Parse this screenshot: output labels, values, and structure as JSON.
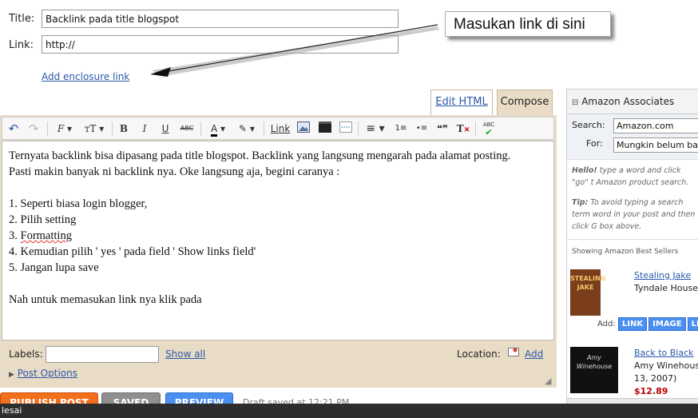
{
  "form": {
    "title_label": "Title:",
    "title_value": "Backlink pada title blogspot",
    "link_label": "Link:",
    "link_value": "http://",
    "enclosure_link": "Add enclosure link"
  },
  "callout": {
    "text": "Masukan link di sini"
  },
  "tabs": {
    "edit_html": "Edit HTML",
    "compose": "Compose"
  },
  "toolbar": {
    "undo": "↶",
    "redo": "↷",
    "font": "F",
    "size": "тT",
    "bold": "B",
    "italic": "I",
    "underline": "U",
    "strike": "ABC",
    "text_color": "A",
    "highlight": "✎",
    "link": "Link",
    "align": "≡",
    "ol": "1≡",
    "ul": "•≡",
    "quote": "❝❞",
    "clear": "T",
    "spell": "ABC"
  },
  "post": {
    "lines": [
      "Ternyata backlink bisa dipasang pada title blogspot. Backlink yang langsung mengarah pada alamat posting.",
      "Pasti makin banyak ni backlink nya. Oke langsung aja, begini caranya :",
      "",
      "1. Seperti biasa login blogger,",
      "2. Pilih setting",
      "3. Formatting",
      "4. Kemudian pilih ' yes ' pada field ' Show links field'",
      "5. Jangan lupa save",
      "",
      "Nah untuk memasukan link nya klik pada"
    ]
  },
  "labels": {
    "label": "Labels:",
    "show_all": "Show all",
    "location_label": "Location:",
    "add": "Add",
    "post_options": "Post Options"
  },
  "actions": {
    "publish": "PUBLISH POST",
    "saved": "SAVED",
    "preview": "PREVIEW",
    "draft_status": "Draft saved at 12:21 PM"
  },
  "sidebar": {
    "title": "Amazon Associates",
    "search_label": "Search:",
    "search_value": "Amazon.com",
    "for_label": "For:",
    "for_value": "Mungkin belum banya",
    "help_prefix": "Hello!",
    "help_text": " type a word and click \"go\" t Amazon product search.",
    "tip_prefix": "Tip:",
    "tip_text": " To avoid typing a search term word in your post and then click G box above.",
    "best_sellers": "Showing Amazon Best Sellers",
    "products": [
      {
        "title": "Stealing Jake",
        "author": "Tyndale House P",
        "cover_text": "STEALING JAKE"
      },
      {
        "title": "Back to Black",
        "author": "Amy Winehouse",
        "date": "13, 2007)",
        "price": "$12.89",
        "cover_text": "Amy Winehouse"
      }
    ],
    "add_label": "Add:",
    "add_buttons": [
      "LINK",
      "IMAGE",
      "LINK"
    ]
  },
  "status": {
    "text": "lesai"
  }
}
